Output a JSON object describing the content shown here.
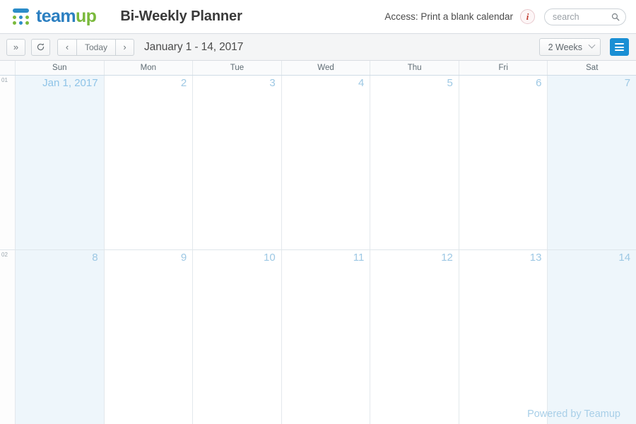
{
  "header": {
    "logo": {
      "icon_name": "teamup-logo-icon",
      "word_first": "team",
      "word_second": "up",
      "color_blue": "#2b7fc1",
      "color_green": "#7ab93c"
    },
    "calendar_title": "Bi-Weekly Planner",
    "access_label": "Access: Print a blank calendar",
    "info_icon": "info-icon",
    "info_glyph": "i",
    "search": {
      "placeholder": "search",
      "value": "",
      "icon": "search-icon"
    }
  },
  "toolbar": {
    "expand_label": "»",
    "expand_icon": "double-chevron-right-icon",
    "refresh_icon": "refresh-icon",
    "prev_label": "‹",
    "today_label": "Today",
    "next_label": "›",
    "date_range": "January 1 - 14, 2017",
    "view_selected": "2 Weeks",
    "view_options": [
      "2 Weeks"
    ],
    "chevron_icon": "chevron-down-icon",
    "menu_icon": "list-menu-icon",
    "accent_color": "#1a8fd4"
  },
  "calendar": {
    "day_headers": [
      "Sun",
      "Mon",
      "Tue",
      "Wed",
      "Thu",
      "Fri",
      "Sat"
    ],
    "weeks": [
      {
        "week_number": "01",
        "days": [
          {
            "label": "Jan 1, 2017",
            "weekend": true,
            "first_of_month": true
          },
          {
            "label": "2",
            "weekend": false,
            "first_of_month": false
          },
          {
            "label": "3",
            "weekend": false,
            "first_of_month": false
          },
          {
            "label": "4",
            "weekend": false,
            "first_of_month": false
          },
          {
            "label": "5",
            "weekend": false,
            "first_of_month": false
          },
          {
            "label": "6",
            "weekend": false,
            "first_of_month": false
          },
          {
            "label": "7",
            "weekend": true,
            "first_of_month": false
          }
        ]
      },
      {
        "week_number": "02",
        "days": [
          {
            "label": "8",
            "weekend": true,
            "first_of_month": false
          },
          {
            "label": "9",
            "weekend": false,
            "first_of_month": false
          },
          {
            "label": "10",
            "weekend": false,
            "first_of_month": false
          },
          {
            "label": "11",
            "weekend": false,
            "first_of_month": false
          },
          {
            "label": "12",
            "weekend": false,
            "first_of_month": false
          },
          {
            "label": "13",
            "weekend": false,
            "first_of_month": false
          },
          {
            "label": "14",
            "weekend": true,
            "first_of_month": false
          }
        ]
      }
    ],
    "footer_credit": "Powered by Teamup"
  }
}
